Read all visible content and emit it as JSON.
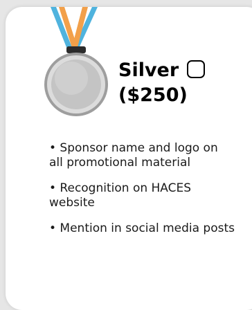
{
  "tier": {
    "name": "Silver",
    "price": "($250)"
  },
  "benefits": [
    {
      "text": "• Sponsor name and logo on all promotional material"
    },
    {
      "text": "• Recognition on HACES website"
    },
    {
      "text": "• Mention in social media posts"
    }
  ],
  "colors": {
    "ribbon_blue": "#4fb3de",
    "ribbon_orange": "#f2a04a",
    "medal_silver": "#c4c4c4",
    "card_background": "#ffffff",
    "page_background": "#e6e6e6"
  },
  "icons": {
    "medal": "silver-medal-icon",
    "selector": "checkbox-empty"
  }
}
